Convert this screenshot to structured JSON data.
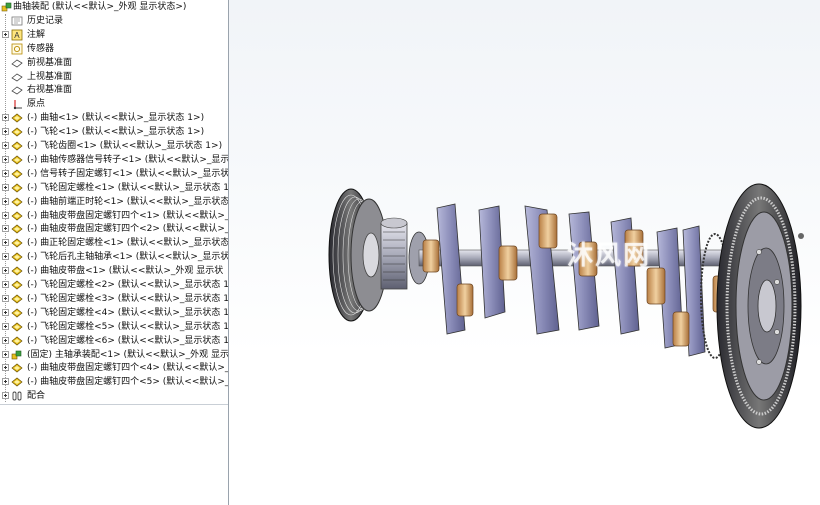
{
  "tree": {
    "root": {
      "label": "曲轴装配 (默认<<默认>_外观 显示状态>)",
      "icon": "assembly-icon"
    },
    "items": [
      {
        "label": "历史记录",
        "icon": "history-icon",
        "expandable": false
      },
      {
        "label": "注解",
        "icon": "annotations-icon",
        "expandable": true
      },
      {
        "label": "传感器",
        "icon": "sensors-icon",
        "expandable": false
      },
      {
        "label": "前视基准面",
        "icon": "plane-icon",
        "expandable": false
      },
      {
        "label": "上视基准面",
        "icon": "plane-icon",
        "expandable": false
      },
      {
        "label": "右视基准面",
        "icon": "plane-icon",
        "expandable": false
      },
      {
        "label": "原点",
        "icon": "origin-icon",
        "expandable": false
      },
      {
        "label": "(-) 曲轴<1> (默认<<默认>_显示状态 1>)",
        "icon": "part-icon",
        "expandable": true
      },
      {
        "label": "(-) 飞轮<1> (默认<<默认>_显示状态 1>)",
        "icon": "part-icon",
        "expandable": true
      },
      {
        "label": "(-) 飞轮齿圈<1> (默认<<默认>_显示状态 1>)",
        "icon": "part-icon",
        "expandable": true
      },
      {
        "label": "(-) 曲轴传感器信号转子<1> (默认<<默认>_显示",
        "icon": "part-icon",
        "expandable": true
      },
      {
        "label": "(-) 信号转子固定螺钉<1> (默认<<默认>_显示状",
        "icon": "part-icon",
        "expandable": true
      },
      {
        "label": "(-) 飞轮固定螺栓<1> (默认<<默认>_显示状态 1",
        "icon": "part-icon",
        "expandable": true
      },
      {
        "label": "(-) 曲轴前端正时轮<1> (默认<<默认>_显示状态",
        "icon": "part-icon",
        "expandable": true
      },
      {
        "label": "(-) 曲轴皮带盘固定螺钉四个<1> (默认<<默认>_",
        "icon": "part-icon",
        "expandable": true
      },
      {
        "label": "(-) 曲轴皮带盘固定螺钉四个<2> (默认<<默认>_",
        "icon": "part-icon",
        "expandable": true
      },
      {
        "label": "(-) 曲正轮固定螺栓<1> (默认<<默认>_显示状态",
        "icon": "part-icon",
        "expandable": true
      },
      {
        "label": "(-) 飞轮后孔主轴轴承<1> (默认<<默认>_显示状",
        "icon": "part-icon",
        "expandable": true
      },
      {
        "label": "(-) 曲轴皮带盘<1> (默认<<默认>_外观 显示状",
        "icon": "part-icon",
        "expandable": true
      },
      {
        "label": "(-) 飞轮固定螺栓<2> (默认<<默认>_显示状态 1",
        "icon": "part-icon",
        "expandable": true
      },
      {
        "label": "(-) 飞轮固定螺栓<3> (默认<<默认>_显示状态 1",
        "icon": "part-icon",
        "expandable": true
      },
      {
        "label": "(-) 飞轮固定螺栓<4> (默认<<默认>_显示状态 1",
        "icon": "part-icon",
        "expandable": true
      },
      {
        "label": "(-) 飞轮固定螺栓<5> (默认<<默认>_显示状态 1",
        "icon": "part-icon",
        "expandable": true
      },
      {
        "label": "(-) 飞轮固定螺栓<6> (默认<<默认>_显示状态 1",
        "icon": "part-icon",
        "expandable": true
      },
      {
        "label": "(固定) 主轴承装配<1> (默认<<默认>_外观 显示",
        "icon": "subassembly-icon",
        "expandable": true
      },
      {
        "label": "(-) 曲轴皮带盘固定螺钉四个<4> (默认<<默认>_",
        "icon": "part-icon",
        "expandable": true
      },
      {
        "label": "(-) 曲轴皮带盘固定螺钉四个<5> (默认<<默认>_",
        "icon": "part-icon",
        "expandable": true
      },
      {
        "label": "配合",
        "icon": "mates-icon",
        "expandable": true
      }
    ]
  },
  "viewport": {
    "watermark": "沐风网"
  },
  "colors": {
    "part_icon_yellow": "#e8c020",
    "bearing_bronze": "#c8935a",
    "crank_web": "#8a8cb8"
  }
}
